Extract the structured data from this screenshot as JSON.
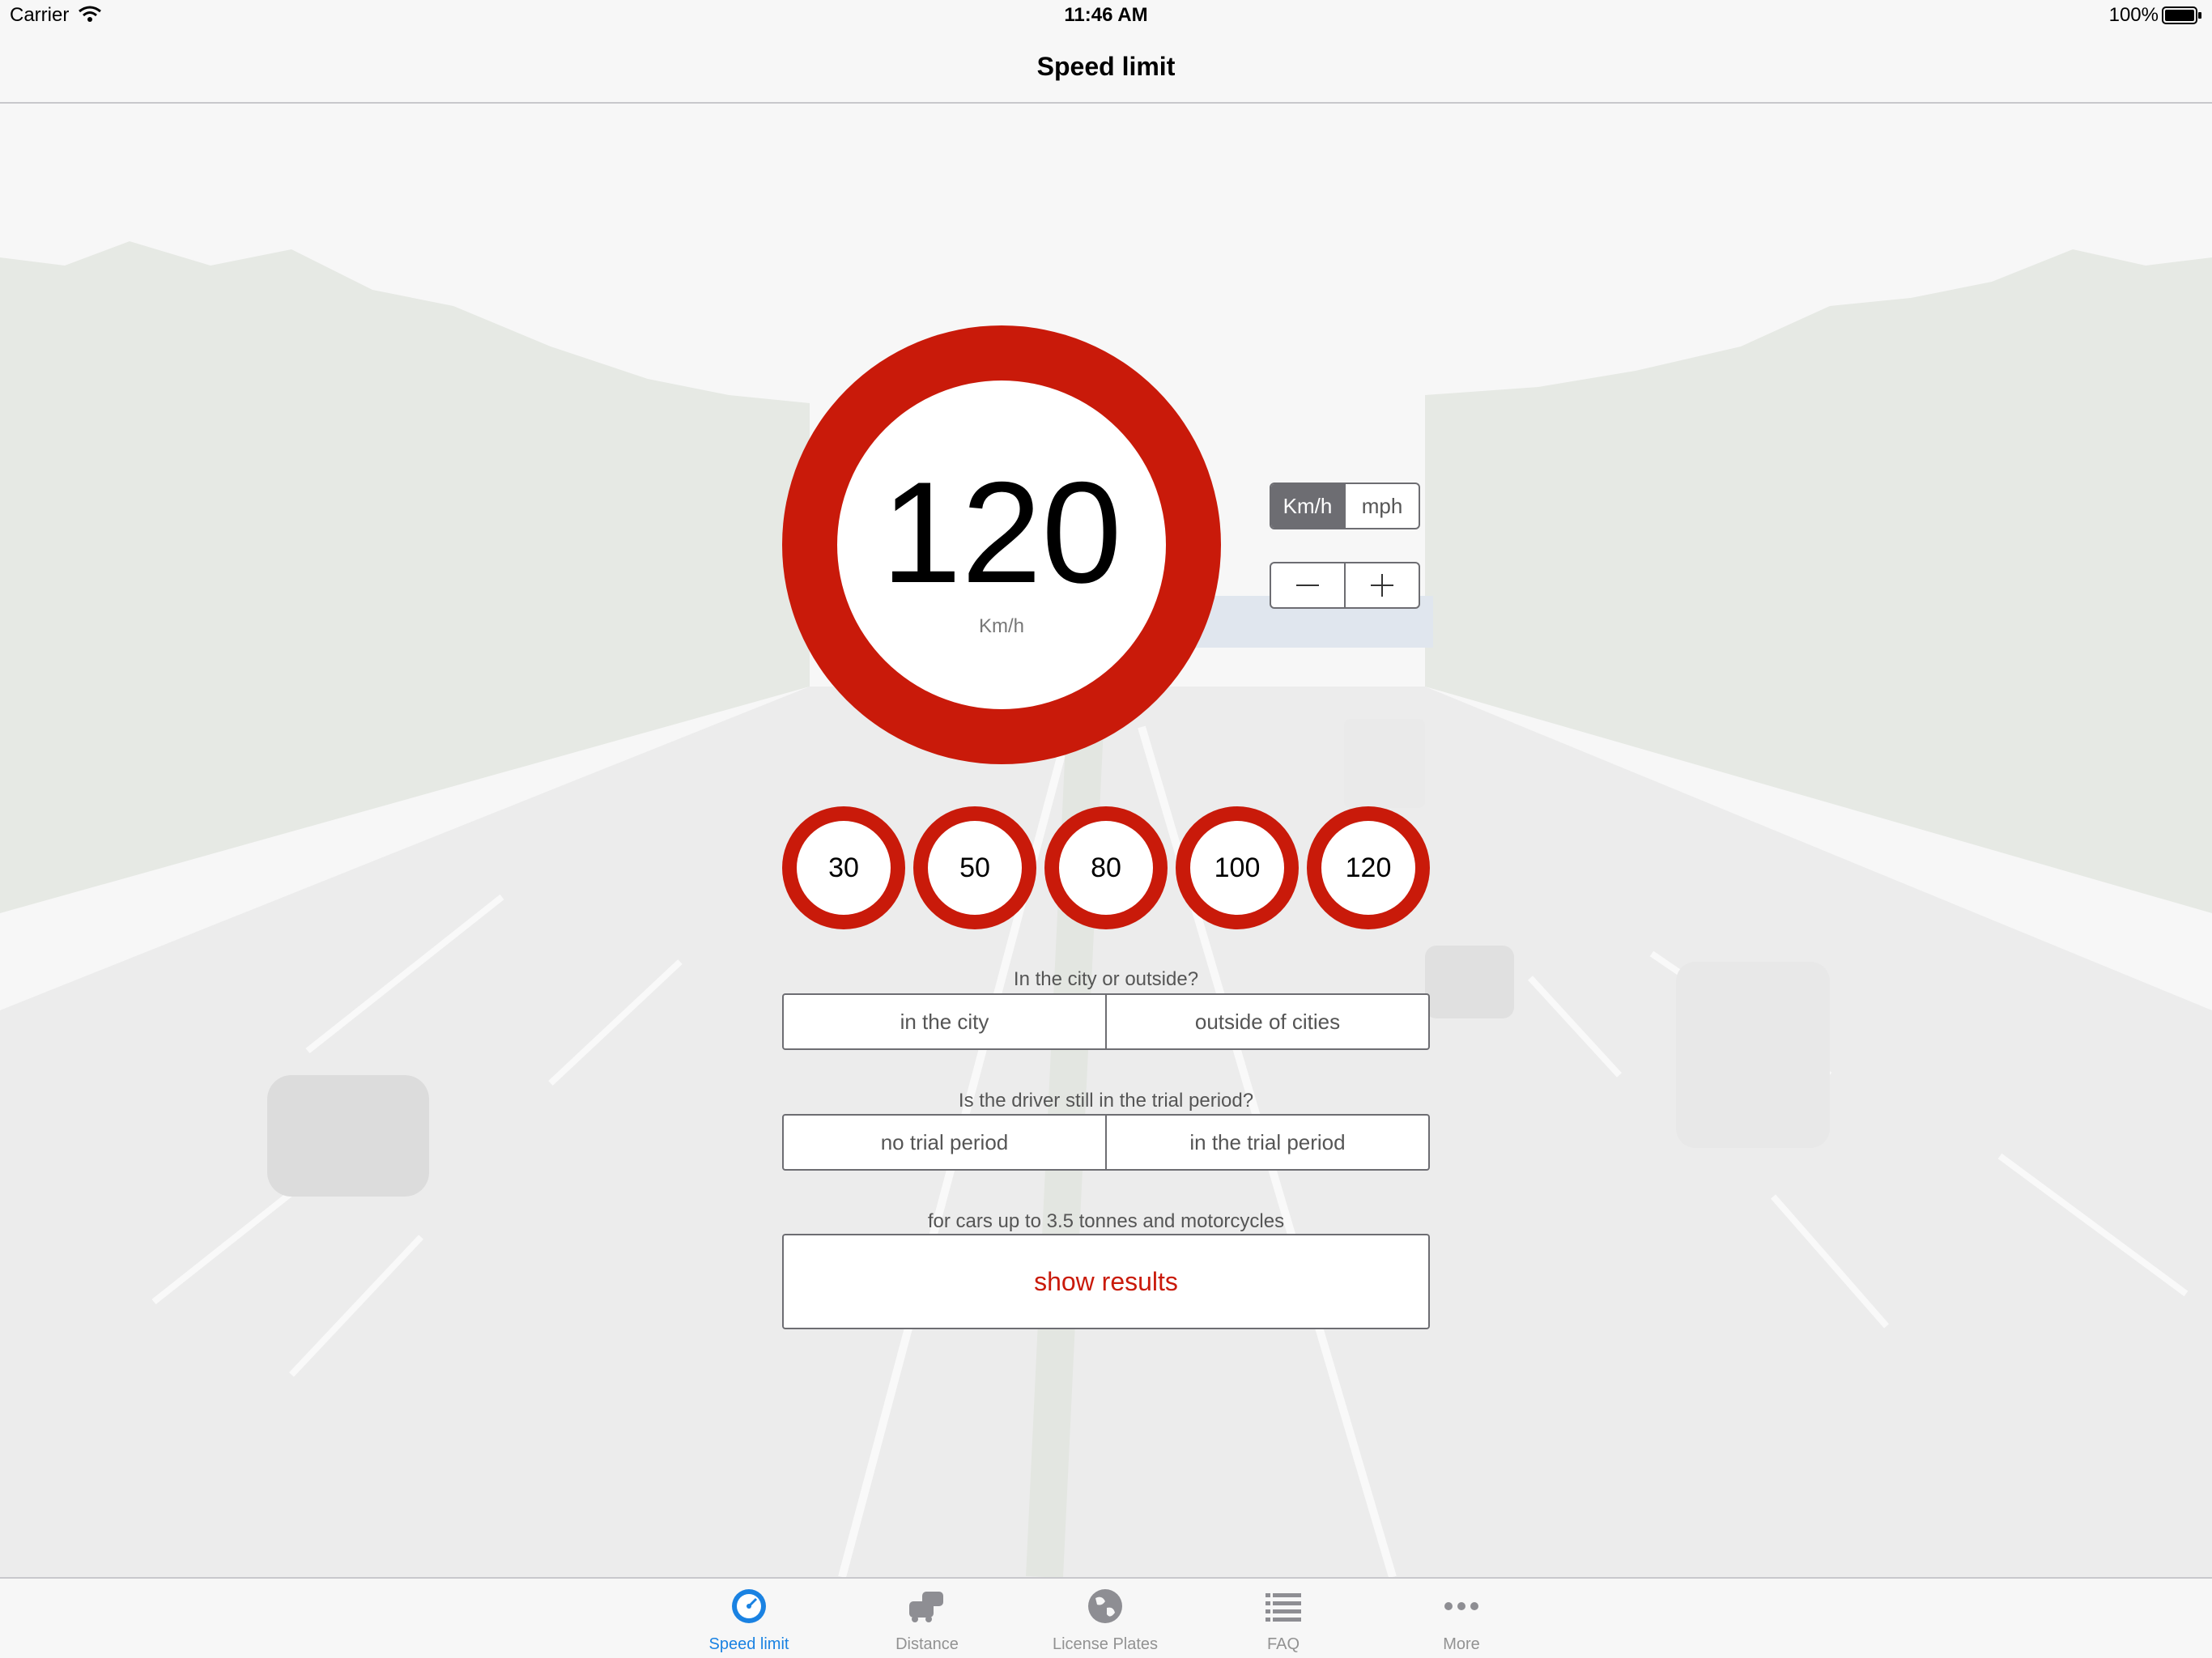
{
  "status_bar": {
    "carrier": "Carrier",
    "time": "11:46 AM",
    "battery": "100%"
  },
  "nav": {
    "title": "Speed limit"
  },
  "speed": {
    "value": "120",
    "unit": "Km/h"
  },
  "unit_toggle": {
    "options": [
      "Km/h",
      "mph"
    ],
    "selected": "Km/h"
  },
  "stepper": {
    "minus": "minus",
    "plus": "plus"
  },
  "presets": [
    "30",
    "50",
    "80",
    "100",
    "120"
  ],
  "location": {
    "question": "In the city or outside?",
    "options": [
      "in the city",
      "outside of cities"
    ]
  },
  "trial": {
    "question": "Is the driver still in the trial period?",
    "options": [
      "no trial period",
      "in the trial period"
    ]
  },
  "vehicle_note": "for cars up to 3.5 tonnes and motorcycles",
  "show_results": "show results",
  "tabs": [
    {
      "label": "Speed limit",
      "icon": "speedometer-icon",
      "active": true
    },
    {
      "label": "Distance",
      "icon": "cars-icon",
      "active": false
    },
    {
      "label": "License Plates",
      "icon": "globe-icon",
      "active": false
    },
    {
      "label": "FAQ",
      "icon": "list-icon",
      "active": false
    },
    {
      "label": "More",
      "icon": "more-icon",
      "active": false
    }
  ],
  "colors": {
    "sign_red": "#c91a0a",
    "tab_active": "#1a82e2",
    "tab_inactive": "#929292",
    "control_border": "#6d6d72"
  }
}
